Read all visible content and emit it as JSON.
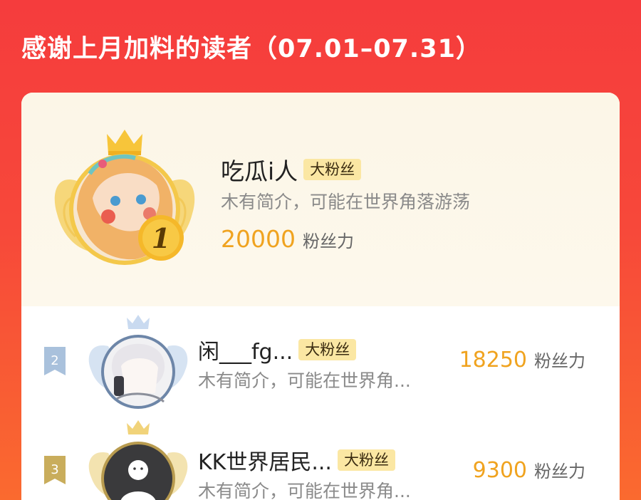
{
  "header": {
    "title": "感谢上月加料的读者（07.01–07.31）"
  },
  "colors": {
    "background_top": "#f53c3d",
    "background_bottom": "#fa6a2f",
    "gold": "#f0a31f",
    "tag_bg": "#fbe7a3",
    "silver_flag": "#a9c1dc",
    "bronze_flag": "#c9ad5c"
  },
  "readers": [
    {
      "rank": "1",
      "name": "吃瓜i人",
      "tag": "大粉丝",
      "bio": "木有简介，可能在世界角落游荡",
      "power": "20000",
      "power_unit": "粉丝力",
      "avatar_icon": "anime-girl-avatar",
      "badge_icon": "gold-crown-wings"
    },
    {
      "rank": "2",
      "name": "闲___fg...",
      "tag": "大粉丝",
      "bio": "木有简介，可能在世界角...",
      "power": "18250",
      "power_unit": "粉丝力",
      "avatar_icon": "anime-boy-avatar",
      "badge_icon": "silver-crown-wings"
    },
    {
      "rank": "3",
      "name": "KK世界居民...",
      "tag": "大粉丝",
      "bio": "木有简介，可能在世界角...",
      "power": "9300",
      "power_unit": "粉丝力",
      "avatar_icon": "default-person-avatar",
      "badge_icon": "bronze-crown-wings"
    }
  ]
}
